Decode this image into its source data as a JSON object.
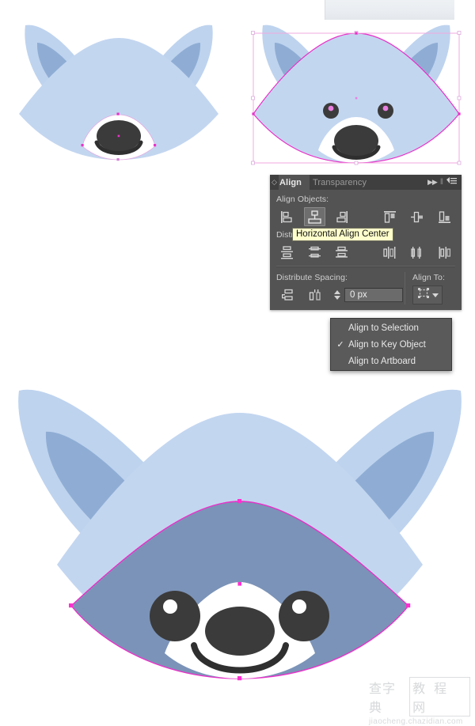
{
  "app": {
    "kind": "vector-illustration-editor",
    "canvas_background": "#ffffff"
  },
  "colors": {
    "panel_bg": "#535353",
    "panel_tabbar_bg": "#3f3f3f",
    "panel_text": "#cfcfcf",
    "panel_text_active": "#e8e8e8",
    "tooltip_bg": "#ffffcc",
    "tooltip_text": "#111111",
    "selection_magenta": "#e832c8",
    "bbox_pink": "#f0a8e0",
    "fur_light": "#bed3ee",
    "fur_light_2": "#c3d6f0",
    "fur_mid": "#8fadd4",
    "face_dark": "#7b93b8",
    "muzzle_white": "#ffffff",
    "nose_dark": "#3b3b3b",
    "eye_dark": "#3b3b3b"
  },
  "align_panel": {
    "grip_icon": "panel-grip-diamond-icon",
    "tabs": [
      {
        "label": "Align",
        "active": true
      },
      {
        "label": "Transparency",
        "active": false
      }
    ],
    "header_tools": {
      "collapse_icon": "double-chevron-right-icon",
      "divider_icon": "vertical-divider-icon",
      "menu_icon": "panel-menu-icon"
    },
    "sections": [
      {
        "label": "Align Objects:",
        "name": "align-objects",
        "buttons": [
          {
            "name": "horizontal-align-left",
            "selected": false
          },
          {
            "name": "horizontal-align-center",
            "selected": true
          },
          {
            "name": "horizontal-align-right",
            "selected": false
          },
          {
            "name": "vertical-align-top",
            "selected": false
          },
          {
            "name": "vertical-align-center",
            "selected": false
          },
          {
            "name": "vertical-align-bottom",
            "selected": false
          }
        ]
      },
      {
        "label": "Distribute Objects:",
        "name": "distribute-objects",
        "buttons": [
          {
            "name": "vertical-distribute-top",
            "selected": false
          },
          {
            "name": "vertical-distribute-center",
            "selected": false
          },
          {
            "name": "vertical-distribute-bottom",
            "selected": false
          },
          {
            "name": "horizontal-distribute-left",
            "selected": false
          },
          {
            "name": "horizontal-distribute-center",
            "selected": false
          },
          {
            "name": "horizontal-distribute-right",
            "selected": false
          }
        ]
      }
    ],
    "distribute_spacing": {
      "label": "Distribute Spacing:",
      "buttons": [
        {
          "name": "vertical-distribute-space",
          "selected": false
        },
        {
          "name": "horizontal-distribute-space",
          "selected": false
        }
      ],
      "stepper": {
        "name": "spacing-value-stepper",
        "value": "0 px",
        "up_icon": "stepper-up-arrow-icon",
        "down_icon": "stepper-down-arrow-icon"
      }
    },
    "align_to": {
      "label": "Align To:",
      "button_icon": "align-to-key-object-icon",
      "dropdown_icon": "caret-down-icon"
    }
  },
  "tooltip": {
    "text": "Horizontal Align Center"
  },
  "dropdown_menu": {
    "items": [
      {
        "label": "Align to Selection",
        "checked": false
      },
      {
        "label": "Align to Key Object",
        "checked": true
      },
      {
        "label": "Align to Artboard",
        "checked": false
      }
    ],
    "check_glyph": "✓"
  },
  "artwork": {
    "top_left": {
      "name": "raccoon-head-unselected",
      "description": "Light blue raccoon head with ears, white muzzle, dark nose and smile",
      "selected": false
    },
    "top_right": {
      "name": "raccoon-head-face-selected",
      "description": "Same raccoon head with magenta selection path, bounding box and two eyes",
      "selected": true
    },
    "bottom": {
      "name": "raccoon-head-large-selected",
      "description": "Large raccoon head with darker blue-grey inner face selected in magenta",
      "selected": true
    }
  },
  "watermark": {
    "cn_left": "查字典",
    "cn_right": "教 程 网",
    "url": "jiaocheng.chazidian.com"
  }
}
